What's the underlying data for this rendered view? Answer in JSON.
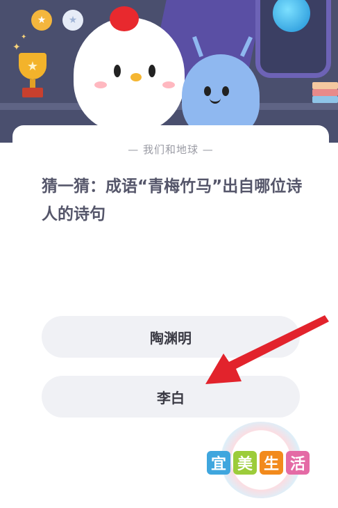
{
  "section_title": "— 我们和地球 —",
  "question": "猜一猜：成语“青梅竹马”出自哪位诗人的诗句",
  "options": [
    {
      "label": "陶渊明"
    },
    {
      "label": "李白"
    }
  ],
  "watermark": {
    "chars": [
      "宜",
      "美",
      "生",
      "活"
    ]
  },
  "colors": {
    "hero_bg": "#4a4f6e",
    "option_bg": "#f0f1f5",
    "arrow": "#e2232c",
    "question_text": "#55566a"
  },
  "icons": [
    "gold-medal-icon",
    "silver-medal-icon",
    "trophy-icon",
    "globe-icon",
    "chicken-mascot",
    "alien-mascot",
    "pointer-arrow-icon"
  ]
}
